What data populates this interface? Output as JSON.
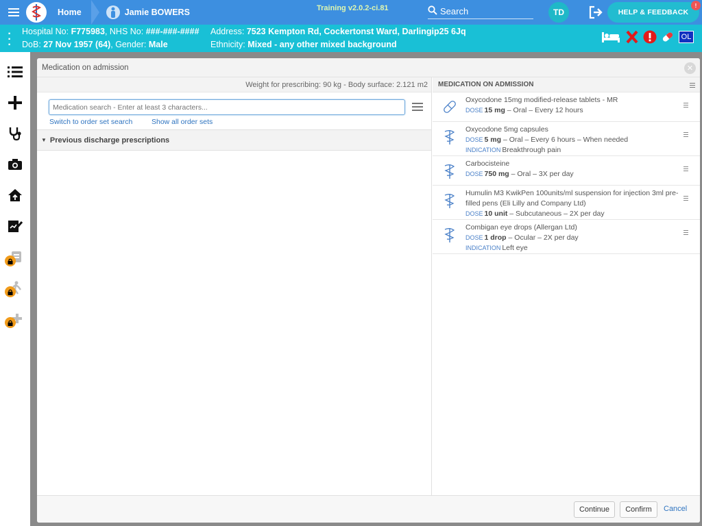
{
  "topbar": {
    "home_label": "Home",
    "patient_name": "Jamie BOWERS",
    "version": "Training v2.0.2-ci.81",
    "search_label": "Search",
    "user_initials": "TD",
    "help_label": "HELP & FEEDBACK",
    "help_badge": "!"
  },
  "banner": {
    "hospital_label": "Hospital No:",
    "hospital_no": "F775983",
    "nhs_label": ", NHS No:",
    "nhs_no": "###-###-####",
    "address_label": "Address:",
    "address": "7523 Kempton Rd, Cockertonst Ward, Darlingip25 6Jq",
    "dob_label": "DoB:",
    "dob": "27 Nov 1957 (64)",
    "gender_label": ", Gender:",
    "gender": "Male",
    "ethnicity_label": "Ethnicity:",
    "ethnicity": "Mixed - any other mixed background",
    "ol_label": "OL"
  },
  "modal": {
    "title": "Medication on admission",
    "weight_text": "Weight for prescribing: 90 kg - Body surface: 2.121 m2",
    "search_placeholder": "Medication search - Enter at least 3 characters...",
    "link_order_set": "Switch to order set search",
    "link_show_all": "Show all order sets",
    "prev_discharge": "Previous discharge prescriptions",
    "right_header": "MEDICATION ON ADMISSION",
    "dose_key": "DOSE",
    "indication_key": "INDICATION",
    "medications": [
      {
        "name": "Oxycodone 15mg modified-release tablets - MR",
        "dose": "15 mg",
        "details": "– Oral – Every 12 hours",
        "indication": ""
      },
      {
        "name": "Oxycodone 5mg capsules",
        "dose": "5 mg",
        "details": "– Oral – Every 6 hours – When needed",
        "indication": "Breakthrough pain"
      },
      {
        "name": "Carbocisteine",
        "dose": "750 mg",
        "details": "– Oral – 3X per day",
        "indication": ""
      },
      {
        "name": "Humulin M3 KwikPen 100units/ml suspension for injection 3ml pre-filled pens (Eli Lilly and Company Ltd)",
        "dose": "10 unit",
        "details": "– Subcutaneous – 2X per day",
        "indication": ""
      },
      {
        "name": "Combigan eye drops (Allergan Ltd)",
        "dose": "1 drop",
        "details": "– Ocular – 2X per day",
        "indication": "Left eye"
      }
    ],
    "continue_label": "Continue",
    "confirm_label": "Confirm",
    "cancel_label": "Cancel"
  },
  "colors": {
    "topbar": "#3d8fe0",
    "banner": "#19c0d6",
    "accent_link": "#2f74c0"
  }
}
